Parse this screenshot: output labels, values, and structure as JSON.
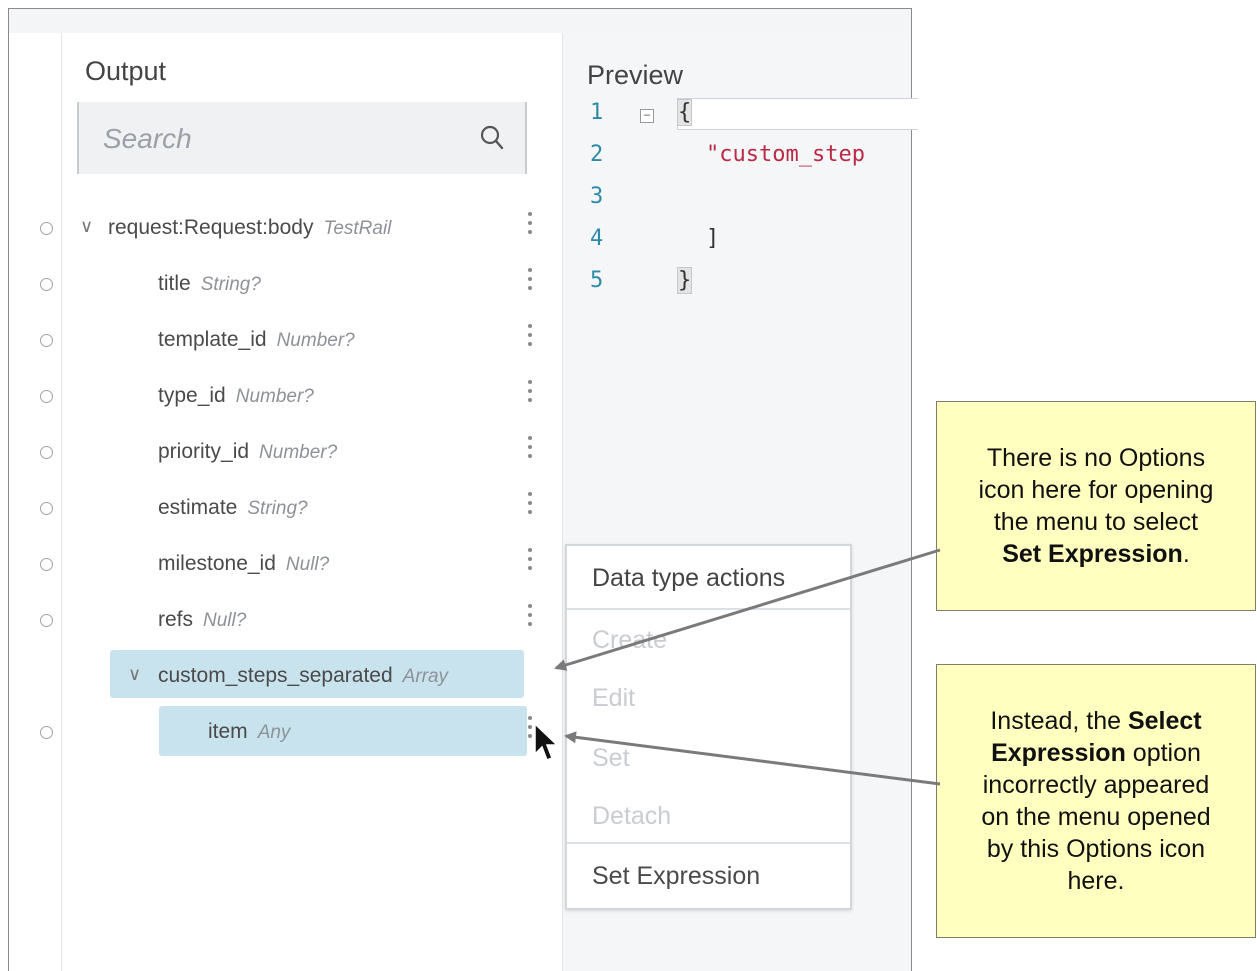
{
  "output": {
    "title": "Output",
    "search_placeholder": "Search",
    "tree": [
      {
        "name": "request:Request:body",
        "type": "TestRail"
      },
      {
        "name": "title",
        "type": "String?"
      },
      {
        "name": "template_id",
        "type": "Number?"
      },
      {
        "name": "type_id",
        "type": "Number?"
      },
      {
        "name": "priority_id",
        "type": "Number?"
      },
      {
        "name": "estimate",
        "type": "String?"
      },
      {
        "name": "milestone_id",
        "type": "Null?"
      },
      {
        "name": "refs",
        "type": "Null?"
      },
      {
        "name": "custom_steps_separated",
        "type": "Array"
      },
      {
        "name": "item",
        "type": "Any"
      }
    ]
  },
  "preview": {
    "title": "Preview",
    "line_numbers": [
      "1",
      "2",
      "3",
      "4",
      "5"
    ],
    "lines": [
      "{",
      "\"custom_step",
      "",
      "]",
      "}"
    ]
  },
  "context_menu": {
    "header": "Data type actions",
    "items": [
      "Create",
      "Edit",
      "Set",
      "Detach"
    ],
    "footer": "Set Expression"
  },
  "callouts": {
    "top": {
      "line1": "There is no Options",
      "line2": "icon here for opening",
      "line3": "the menu to select",
      "bold": "Set Expression",
      "end": "."
    },
    "bottom": {
      "pre": "Instead, the ",
      "bold1": "Select",
      "bold2": "Expression",
      "mid": " option",
      "line3": "incorrectly appeared",
      "line4": "on the menu opened",
      "line5": "by this Options icon",
      "line6": "here."
    }
  },
  "colors": {
    "highlight": "#c8e3ee",
    "note_bg": "#ffffc0",
    "line_number": "#2d8aa8",
    "string": "#b82a45"
  }
}
